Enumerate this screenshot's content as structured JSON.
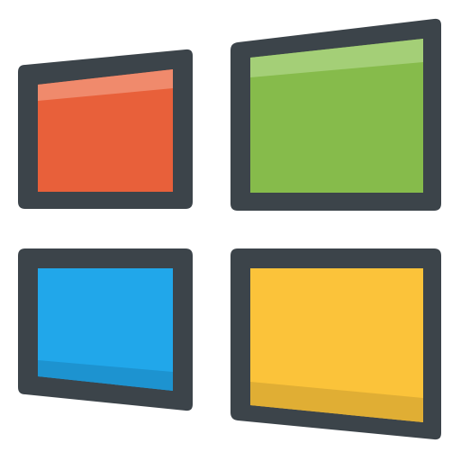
{
  "logo": {
    "icon": "windows-logo-icon",
    "frame_color": "#3c444a",
    "panes": [
      {
        "name": "top-left",
        "color": "#e8603a",
        "highlight": "#f08a6c"
      },
      {
        "name": "top-right",
        "color": "#86bb4b",
        "highlight": "#a4cf77"
      },
      {
        "name": "bottom-left",
        "color": "#21a7ea",
        "shadow": "#1d93d0"
      },
      {
        "name": "bottom-right",
        "color": "#fbc33a",
        "shadow": "#e0ae34"
      }
    ]
  }
}
